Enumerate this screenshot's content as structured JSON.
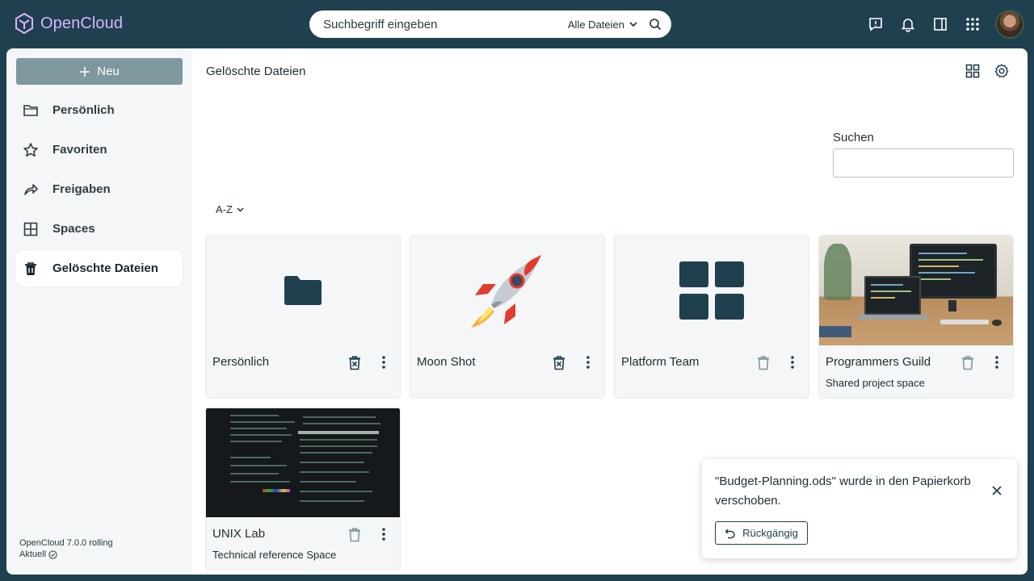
{
  "app": {
    "name": "OpenCloud",
    "brand_color": "#d6b6ff",
    "accent": "#20404f"
  },
  "search": {
    "placeholder": "Suchbegriff eingeben",
    "scope": "Alle Dateien"
  },
  "topbar": {
    "icons": [
      "feedback-icon",
      "bell-icon",
      "sidebar-panel-icon",
      "app-grid-icon"
    ]
  },
  "sidebar": {
    "new_label": "Neu",
    "items": [
      {
        "label": "Persönlich",
        "icon": "folder-icon"
      },
      {
        "label": "Favoriten",
        "icon": "star-icon"
      },
      {
        "label": "Freigaben",
        "icon": "share-icon"
      },
      {
        "label": "Spaces",
        "icon": "spaces-icon"
      },
      {
        "label": "Gelöschte Dateien",
        "icon": "trash-icon",
        "active": true
      }
    ],
    "version": "OpenCloud 7.0.0 rolling",
    "version_status": "Aktuell"
  },
  "main": {
    "breadcrumb": "Gelöschte Dateien",
    "filter_label": "Suchen",
    "sort_label": "A-Z",
    "cards": [
      {
        "title": "Persönlich",
        "subtitle": ""
      },
      {
        "title": "Moon Shot",
        "subtitle": ""
      },
      {
        "title": "Platform Team",
        "subtitle": ""
      },
      {
        "title": "Programmers Guild",
        "subtitle": "Shared project space"
      },
      {
        "title": "UNIX Lab",
        "subtitle": "Technical reference Space"
      }
    ]
  },
  "toast": {
    "message": "\"Budget-Planning.ods\" wurde in den Papierkorb verschoben.",
    "undo_label": "Rückgängig"
  }
}
